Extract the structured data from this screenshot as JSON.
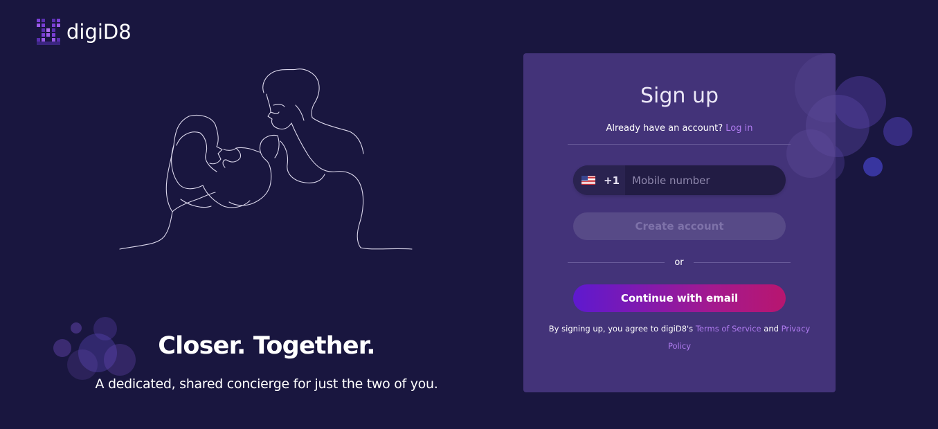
{
  "brand": {
    "name": "digiD8"
  },
  "hero": {
    "title": "Closer. Together.",
    "subtitle": "A dedicated, shared concierge for just the two of you."
  },
  "signup": {
    "heading": "Sign up",
    "login_prompt": "Already have an account?",
    "login_link": "Log in",
    "country_flag": "us-flag-icon",
    "dial_code": "+1",
    "phone_placeholder": "Mobile number",
    "phone_value": "",
    "create_button": "Create account",
    "create_enabled": false,
    "or_text": "or",
    "email_button": "Continue with email",
    "terms_prefix": "By signing up, you agree to digiD8's",
    "terms_link": "Terms of Service",
    "terms_and": "and",
    "privacy_link": "Privacy Policy"
  },
  "colors": {
    "background": "#19163f",
    "card": "#433379",
    "accent_link": "#b07cf0",
    "gradient_start": "#5e19cf",
    "gradient_end": "#b8166f",
    "disabled_button": "#574a87"
  }
}
